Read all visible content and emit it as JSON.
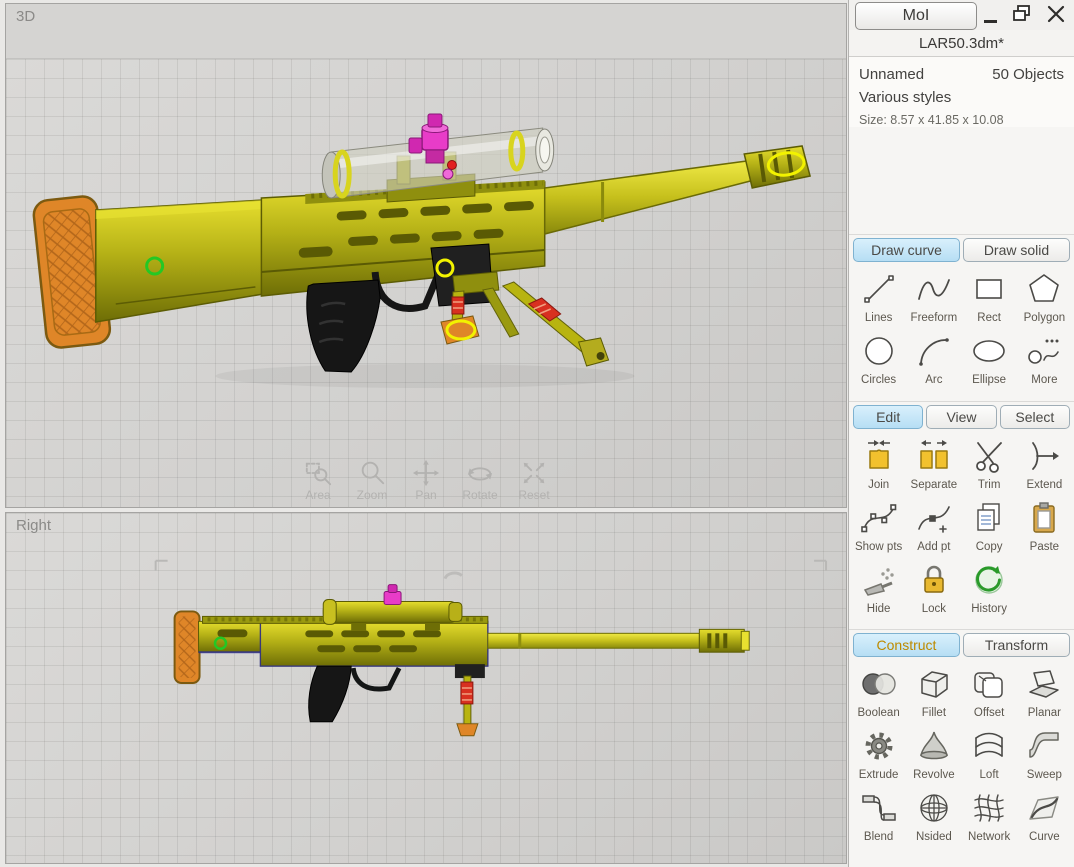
{
  "window": {
    "app_title": "MoI",
    "filename": "LAR50.3dm*"
  },
  "info": {
    "object_name": "Unnamed",
    "object_count": "50 Objects",
    "styles": "Various styles",
    "size": "Size: 8.57 x 41.85 x 10.08"
  },
  "viewports": {
    "top_label": "3D",
    "bottom_label": "Right"
  },
  "view_controls": [
    "Area",
    "Zoom",
    "Pan",
    "Rotate",
    "Reset"
  ],
  "tabs": {
    "draw_curve": "Draw curve",
    "draw_solid": "Draw solid",
    "edit": "Edit",
    "view": "View",
    "select": "Select",
    "construct": "Construct",
    "transform": "Transform"
  },
  "tools": {
    "draw": [
      "Lines",
      "Freeform",
      "Rect",
      "Polygon",
      "Circles",
      "Arc",
      "Ellipse",
      "More"
    ],
    "edit": [
      "Join",
      "Separate",
      "Trim",
      "Extend",
      "Show pts",
      "Add pt",
      "Copy",
      "Paste",
      "Hide",
      "Lock",
      "History"
    ],
    "construct": [
      "Boolean",
      "Fillet",
      "Offset",
      "Planar",
      "Extrude",
      "Revolve",
      "Loft",
      "Sweep",
      "Blend",
      "Nsided",
      "Network",
      "Curve"
    ]
  },
  "colors": {
    "active_tab": "#bde0f4",
    "construct_tab_text": "#bd8a00",
    "rifle_yellow": "#c6c01c",
    "rifle_olive": "#6e6e06",
    "buttpad_orange": "#df8628",
    "grip_black": "#161616",
    "knob_magenta": "#e83cc8",
    "spring_red": "#d83020",
    "selection_yellow": "#f2f200",
    "selection_green": "#24c824"
  }
}
